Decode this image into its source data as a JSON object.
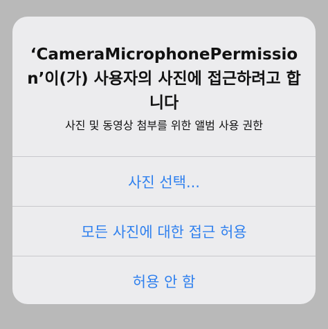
{
  "alert": {
    "title": "‘CameraMicrophonePermission’이(가) 사용자의 사진에 접근하려고 합니다",
    "message": "사진 및 동영상 첨부를 위한 앨범 사용 권한",
    "buttons": [
      {
        "label": "사진 선택..."
      },
      {
        "label": "모든 사진에 대한 접근 허용"
      },
      {
        "label": "허용 안 함"
      }
    ]
  }
}
